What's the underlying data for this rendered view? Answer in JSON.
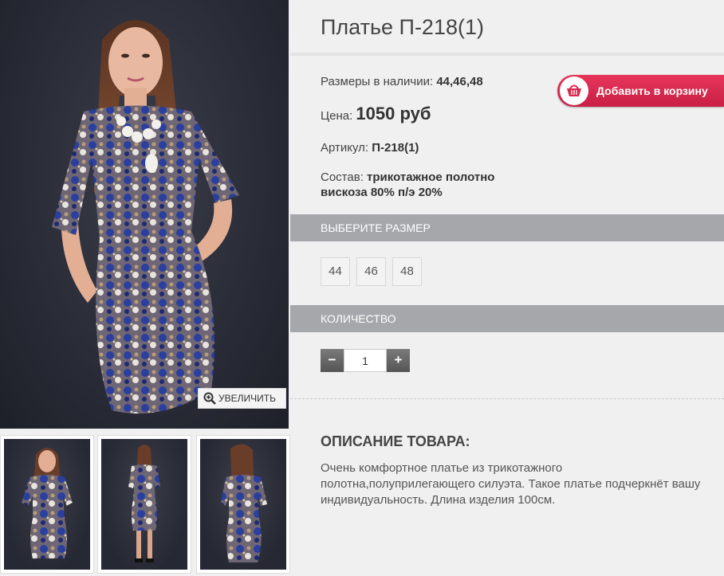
{
  "gallery": {
    "zoom_label": "УВЕЛИЧИТЬ",
    "thumbnails": [
      "thumb-front",
      "thumb-front-full",
      "thumb-back"
    ]
  },
  "product": {
    "title": "Платье П-218(1)",
    "sizes_label": "Размеры в наличии:",
    "sizes_value": "44,46,48",
    "price_label": "Цена:",
    "price_value": "1050 руб",
    "sku_label": "Артикул:",
    "sku_value": "П-218(1)",
    "composition_label": "Состав:",
    "composition_line1": "трикотажное полотно",
    "composition_line2": "вискоза 80% п/э 20%"
  },
  "cart": {
    "label": "Добавить в корзину"
  },
  "size_section": {
    "title": "ВЫБЕРИТЕ РАЗМЕР",
    "options": [
      "44",
      "46",
      "48"
    ]
  },
  "quantity_section": {
    "title": "КОЛИЧЕСТВО",
    "minus": "−",
    "plus": "+",
    "value": "1"
  },
  "description": {
    "title": "ОПИСАНИЕ ТОВАРА:",
    "text": "Очень комфортное платье из трикотажного полотна,полуприлегающего силуэта. Такое платье подчеркнёт вашу индивидуальность. Длина изделия 100см."
  },
  "colors": {
    "accent": "#d6284e",
    "section_bar": "#a5a7aa",
    "dress_blue": "#2a3f9e"
  }
}
